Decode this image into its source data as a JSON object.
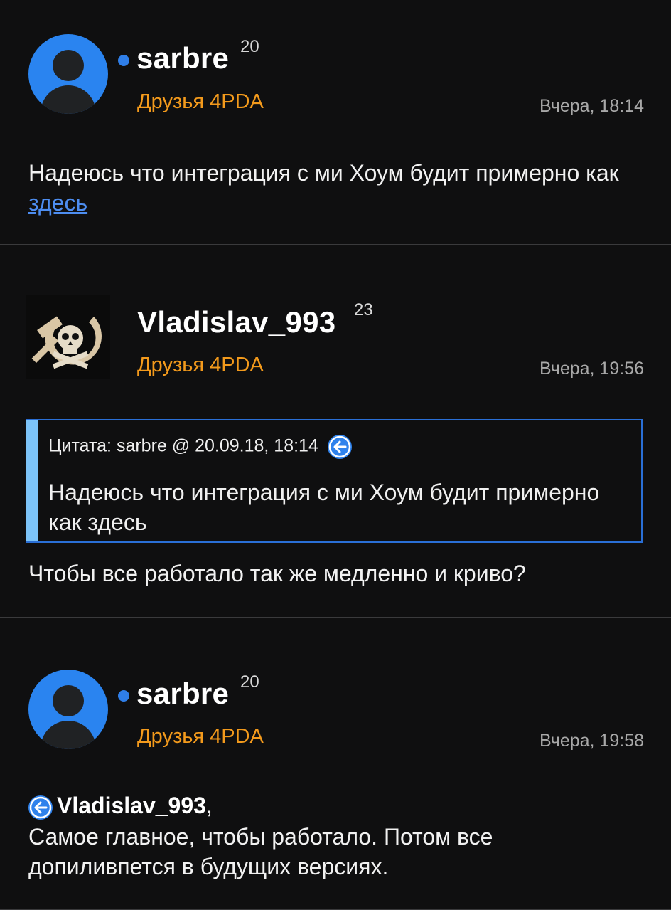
{
  "posts": [
    {
      "username": "sarbre",
      "reputation": "20",
      "group": "Друзья 4PDA",
      "time": "Вчера, 18:14",
      "text_before_link": "Надеюсь что интеграция с ми Хоум будит примерно как ",
      "link_text": "здесь"
    },
    {
      "username": "Vladislav_993",
      "reputation": "23",
      "group": "Друзья 4PDA",
      "time": "Вчера, 19:56",
      "quote_header": "Цитата: sarbre @ 20.09.18, 18:14",
      "quote_text": "Надеюсь что интеграция с ми Хоум будит примерно как здесь",
      "text": "Чтобы все работало так же медленно и криво?"
    },
    {
      "username": "sarbre",
      "reputation": "20",
      "group": "Друзья 4PDA",
      "time": "Вчера, 19:58",
      "mention": "Vladislav_993",
      "mention_suffix": ",",
      "text": "Самое главное, чтобы работало. Потом все допиливпется в будущих версиях."
    }
  ],
  "colors": {
    "background": "#0f0f10",
    "group": "#f39a1c",
    "link": "#4d8df0",
    "online": "#2f7ee8",
    "quote_border": "#2a6fd6",
    "quote_bar": "#7cc3f7"
  },
  "icons": [
    "default-avatar-icon",
    "hammer-sickle-skull-avatar",
    "online-dot-icon",
    "go-to-post-arrow-icon"
  ]
}
